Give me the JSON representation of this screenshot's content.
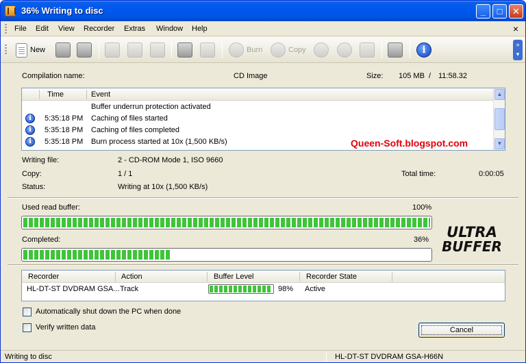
{
  "window": {
    "title": "36% Writing to disc"
  },
  "menu": [
    "File",
    "Edit",
    "View",
    "Recorder",
    "Extras",
    "Window",
    "Help"
  ],
  "toolbar": {
    "new_label": "New",
    "burn_label": "Burn",
    "copy_label": "Copy",
    "icons": [
      "new-document-icon",
      "open-icon",
      "save-icon",
      "cut-icon",
      "copy-icon",
      "paste-icon",
      "properties-icon",
      "edit-icon",
      "burn-icon",
      "copy-disc-icon",
      "disc-info-icon",
      "eject-icon",
      "erase-icon",
      "drives-icon",
      "info-icon"
    ]
  },
  "compilation": {
    "name_label": "Compilation name:",
    "name_value": "CD Image",
    "size_label": "Size:",
    "size_value": "105 MB",
    "size_sep": "/",
    "duration": "11:58.32"
  },
  "log": {
    "columns": {
      "time": "Time",
      "event": "Event"
    },
    "rows": [
      {
        "icon": false,
        "time": "",
        "event": "Buffer underrun protection activated"
      },
      {
        "icon": true,
        "time": "5:35:18 PM",
        "event": "Caching of files started"
      },
      {
        "icon": true,
        "time": "5:35:18 PM",
        "event": "Caching of files completed"
      },
      {
        "icon": true,
        "time": "5:35:18 PM",
        "event": "Burn process started at 10x (1,500 KB/s)"
      }
    ]
  },
  "watermark": "Queen-Soft.blogspot.com",
  "status_info": {
    "writing_file_label": "Writing file:",
    "writing_file_value": "2 - CD-ROM Mode 1, ISO 9660",
    "copy_label": "Copy:",
    "copy_value": "1 / 1",
    "status_label": "Status:",
    "status_value": "Writing at 10x (1,500 KB/s)",
    "total_time_label": "Total time:",
    "total_time_value": "0:00:05"
  },
  "buffer": {
    "label": "Used read buffer:",
    "percent_text": "100%",
    "fraction": 1.0
  },
  "completed": {
    "label": "Completed:",
    "percent_text": "36%",
    "fraction": 0.36
  },
  "logo_text": [
    "ULTRA",
    "BUFFER"
  ],
  "recorder_table": {
    "columns": [
      "Recorder",
      "Action",
      "Buffer Level",
      "Recorder State"
    ],
    "row": {
      "recorder": "HL-DT-ST DVDRAM GSA...",
      "action": "Track",
      "buffer_level_text": "98%",
      "buffer_level_fraction": 0.98,
      "state": "Active"
    }
  },
  "options": {
    "shutdown_label": "Automatically shut down the PC when done",
    "shutdown_checked": false,
    "verify_label": "Verify written data",
    "verify_checked": false
  },
  "cancel_label": "Cancel",
  "statusbar": {
    "left": "Writing to disc",
    "right": "HL-DT-ST DVDRAM GSA-H66N"
  }
}
